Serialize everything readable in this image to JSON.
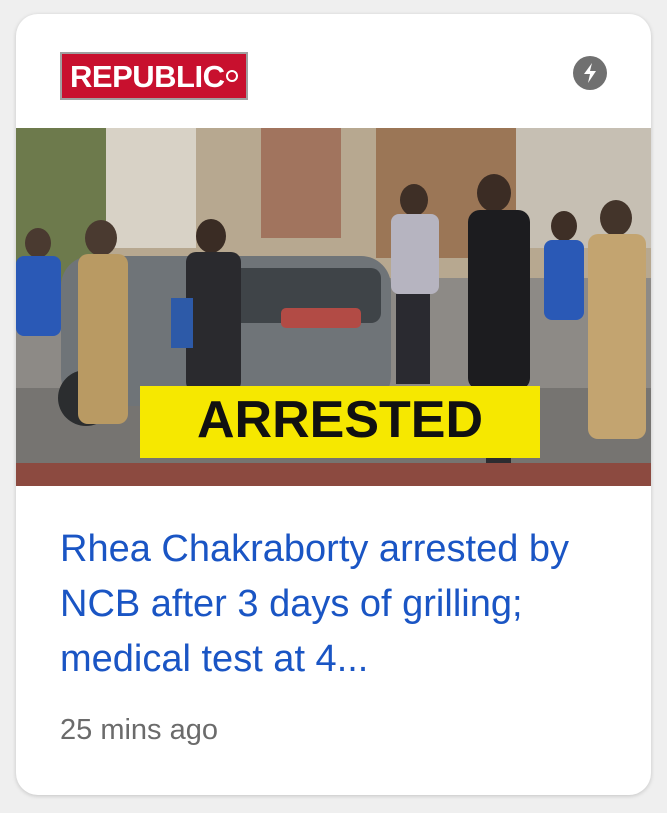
{
  "card": {
    "source_logo_text": "REPUBLIC",
    "amp_icon": "lightning-bolt-icon",
    "image_banner_text": "ARRESTED",
    "headline": "Rhea Chakraborty arrested by NCB after 3 days of grilling; medical test at 4...",
    "timestamp": "25 mins ago"
  },
  "colors": {
    "headline": "#1a55c4",
    "logo_bg": "#c8102e",
    "banner_bg": "#f6e800",
    "timestamp": "#6b6b6b"
  }
}
